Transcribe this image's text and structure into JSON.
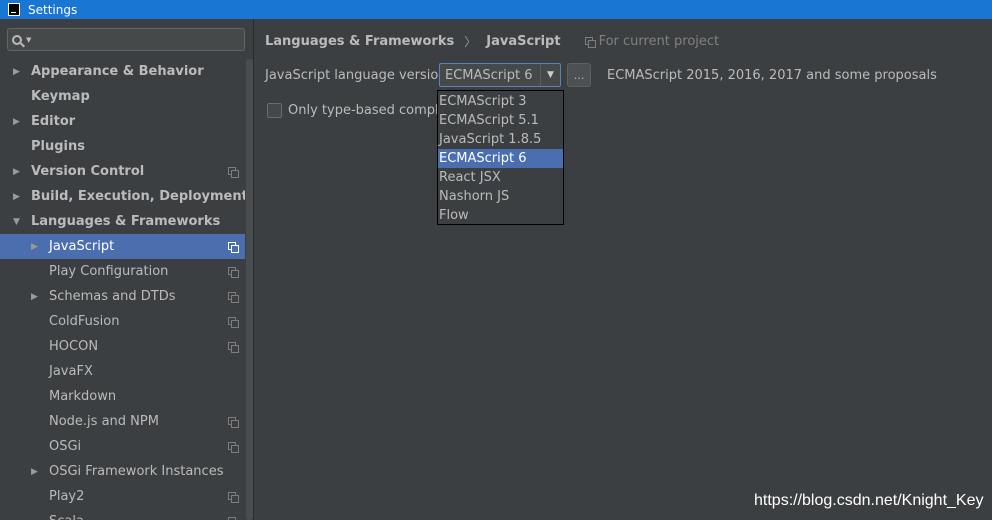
{
  "window": {
    "title": "Settings"
  },
  "search": {
    "value": "",
    "placeholder": ""
  },
  "tree": [
    {
      "label": "Appearance & Behavior",
      "arrow": "▶",
      "bold": true,
      "indent": 0,
      "project": false
    },
    {
      "label": "Keymap",
      "arrow": "",
      "bold": true,
      "indent": 0,
      "project": false
    },
    {
      "label": "Editor",
      "arrow": "▶",
      "bold": true,
      "indent": 0,
      "project": false
    },
    {
      "label": "Plugins",
      "arrow": "",
      "bold": true,
      "indent": 0,
      "project": false
    },
    {
      "label": "Version Control",
      "arrow": "▶",
      "bold": true,
      "indent": 0,
      "project": true
    },
    {
      "label": "Build, Execution, Deployment",
      "arrow": "▶",
      "bold": true,
      "indent": 0,
      "project": false
    },
    {
      "label": "Languages & Frameworks",
      "arrow": "▼",
      "bold": true,
      "indent": 0,
      "project": false
    },
    {
      "label": "JavaScript",
      "arrow": "▶",
      "bold": false,
      "indent": 1,
      "project": true,
      "selected": true
    },
    {
      "label": "Play Configuration",
      "arrow": "",
      "bold": false,
      "indent": 1,
      "project": true
    },
    {
      "label": "Schemas and DTDs",
      "arrow": "▶",
      "bold": false,
      "indent": 1,
      "project": true
    },
    {
      "label": "ColdFusion",
      "arrow": "",
      "bold": false,
      "indent": 1,
      "project": true
    },
    {
      "label": "HOCON",
      "arrow": "",
      "bold": false,
      "indent": 1,
      "project": true
    },
    {
      "label": "JavaFX",
      "arrow": "",
      "bold": false,
      "indent": 1,
      "project": false
    },
    {
      "label": "Markdown",
      "arrow": "",
      "bold": false,
      "indent": 1,
      "project": false
    },
    {
      "label": "Node.js and NPM",
      "arrow": "",
      "bold": false,
      "indent": 1,
      "project": true
    },
    {
      "label": "OSGi",
      "arrow": "",
      "bold": false,
      "indent": 1,
      "project": true
    },
    {
      "label": "OSGi Framework Instances",
      "arrow": "▶",
      "bold": false,
      "indent": 1,
      "project": false
    },
    {
      "label": "Play2",
      "arrow": "",
      "bold": false,
      "indent": 1,
      "project": true
    },
    {
      "label": "Scala",
      "arrow": "",
      "bold": false,
      "indent": 1,
      "project": true
    }
  ],
  "breadcrumb": {
    "parent": "Languages & Frameworks",
    "separator": "〉",
    "current": "JavaScript",
    "scope": "For current project"
  },
  "settings": {
    "version_label": "JavaScript language version",
    "version_value": "ECMAScript 6",
    "ellipsis_label": "...",
    "version_description": "ECMAScript 2015, 2016, 2017 and some proposals",
    "checkbox_label": "Only type-based completion",
    "checkbox_checked": false
  },
  "dropdown": {
    "options": [
      "ECMAScript 3",
      "ECMAScript 5.1",
      "JavaScript 1.8.5",
      "ECMAScript 6",
      "React JSX",
      "Nashorn JS",
      "Flow"
    ],
    "selected_index": 3
  },
  "watermark": "https://blog.csdn.net/Knight_Key",
  "colors": {
    "titlebar": "#1976d2",
    "panel": "#3c3f41",
    "selection": "#4b6eaf",
    "text": "#bbbbbb"
  }
}
